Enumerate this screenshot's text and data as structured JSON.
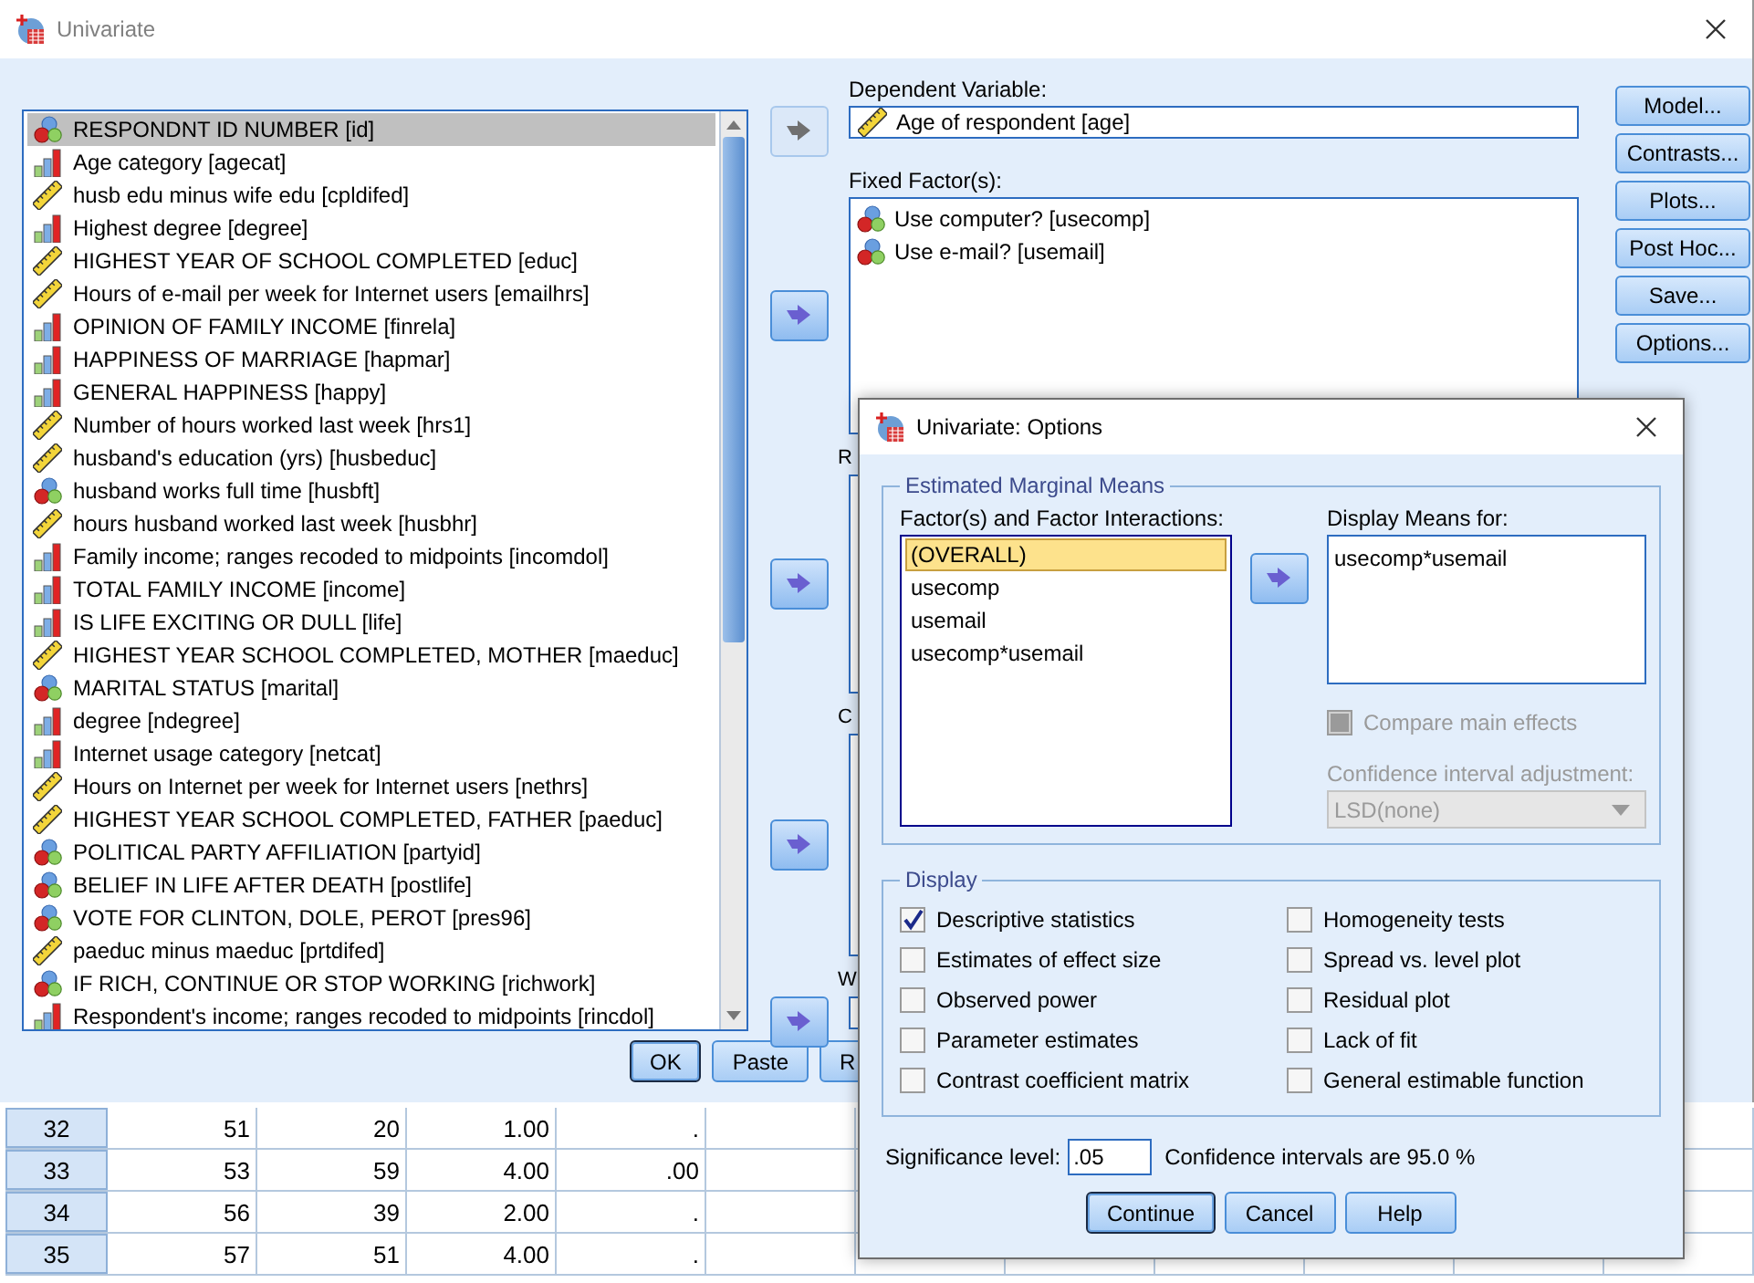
{
  "window": {
    "title": "Univariate"
  },
  "variables": [
    {
      "label": "RESPONDNT ID NUMBER [id]",
      "kind": "nominal",
      "selected": true
    },
    {
      "label": "Age category [agecat]",
      "kind": "ordinal",
      "selected": false
    },
    {
      "label": "husb edu minus wife edu [cpldifed]",
      "kind": "scale",
      "selected": false
    },
    {
      "label": "Highest degree [degree]",
      "kind": "ordinal",
      "selected": false
    },
    {
      "label": "HIGHEST YEAR OF SCHOOL COMPLETED [educ]",
      "kind": "scale",
      "selected": false
    },
    {
      "label": "Hours of e-mail per week for Internet users [emailhrs]",
      "kind": "scale",
      "selected": false
    },
    {
      "label": "OPINION OF FAMILY INCOME [finrela]",
      "kind": "ordinal",
      "selected": false
    },
    {
      "label": "HAPPINESS OF MARRIAGE [hapmar]",
      "kind": "ordinal",
      "selected": false
    },
    {
      "label": "GENERAL HAPPINESS [happy]",
      "kind": "ordinal",
      "selected": false
    },
    {
      "label": "Number of hours worked last week [hrs1]",
      "kind": "scale",
      "selected": false
    },
    {
      "label": "husband's education (yrs) [husbeduc]",
      "kind": "scale",
      "selected": false
    },
    {
      "label": "husband works full time [husbft]",
      "kind": "nominal",
      "selected": false
    },
    {
      "label": "hours husband worked last week [husbhr]",
      "kind": "scale",
      "selected": false
    },
    {
      "label": "Family income; ranges recoded to midpoints [incomdol]",
      "kind": "ordinal",
      "selected": false
    },
    {
      "label": "TOTAL FAMILY INCOME [income]",
      "kind": "ordinal",
      "selected": false
    },
    {
      "label": "IS LIFE EXCITING OR DULL [life]",
      "kind": "ordinal",
      "selected": false
    },
    {
      "label": "HIGHEST YEAR SCHOOL COMPLETED, MOTHER [maeduc]",
      "kind": "scale",
      "selected": false
    },
    {
      "label": "MARITAL STATUS [marital]",
      "kind": "nominal",
      "selected": false
    },
    {
      "label": "degree [ndegree]",
      "kind": "ordinal",
      "selected": false
    },
    {
      "label": "Internet usage category [netcat]",
      "kind": "ordinal",
      "selected": false
    },
    {
      "label": "Hours on Internet per week for Internet users [nethrs]",
      "kind": "scale",
      "selected": false
    },
    {
      "label": "HIGHEST YEAR SCHOOL COMPLETED, FATHER [paeduc]",
      "kind": "scale",
      "selected": false
    },
    {
      "label": "POLITICAL PARTY AFFILIATION [partyid]",
      "kind": "nominal",
      "selected": false
    },
    {
      "label": "BELIEF IN LIFE AFTER DEATH [postlife]",
      "kind": "nominal",
      "selected": false
    },
    {
      "label": "VOTE FOR CLINTON, DOLE, PEROT [pres96]",
      "kind": "nominal",
      "selected": false
    },
    {
      "label": "paeduc minus maeduc [prtdifed]",
      "kind": "scale",
      "selected": false
    },
    {
      "label": "IF RICH, CONTINUE OR STOP WORKING [richwork]",
      "kind": "nominal",
      "selected": false
    },
    {
      "label": "Respondent's income; ranges recoded to midpoints [rincdol]",
      "kind": "ordinal",
      "selected": false
    }
  ],
  "sections": [
    {
      "label": "Dependent Variable:",
      "kind": "field",
      "move_disabled": true,
      "items": [
        {
          "label": "Age of respondent [age]",
          "kind": "scale"
        }
      ]
    },
    {
      "label": "Fixed Factor(s):",
      "kind": "list",
      "move_disabled": false,
      "items": [
        {
          "label": "Use computer? [usecomp]",
          "kind": "nominal"
        },
        {
          "label": "Use e-mail? [usemail]",
          "kind": "nominal"
        }
      ]
    },
    {
      "label": "R",
      "kind": "list",
      "move_disabled": false
    },
    {
      "label": "C",
      "kind": "list",
      "move_disabled": false
    },
    {
      "label": "W",
      "kind": "field",
      "move_disabled": false
    }
  ],
  "side_buttons": [
    "Model...",
    "Contrasts...",
    "Plots...",
    "Post Hoc...",
    "Save...",
    "Options..."
  ],
  "bottom_buttons": [
    {
      "label": "OK",
      "default": true
    },
    {
      "label": "Paste",
      "default": false
    },
    {
      "label": "R",
      "default": false
    }
  ],
  "grid": {
    "rows": [
      {
        "header": "32",
        "cells": [
          "51",
          "20",
          "1.00",
          "."
        ]
      },
      {
        "header": "33",
        "cells": [
          "53",
          "59",
          "4.00",
          ".00"
        ]
      },
      {
        "header": "34",
        "cells": [
          "56",
          "39",
          "2.00",
          "."
        ]
      },
      {
        "header": "35",
        "cells": [
          "57",
          "51",
          "4.00",
          "."
        ]
      }
    ]
  },
  "options_dialog": {
    "title": "Univariate: Options",
    "marginal_means": {
      "title": "Estimated Marginal Means",
      "factors_label": "Factor(s) and Factor Interactions:",
      "factors": [
        {
          "label": "(OVERALL)",
          "selected": true
        },
        {
          "label": "usecomp",
          "selected": false
        },
        {
          "label": "usemail",
          "selected": false
        },
        {
          "label": "usecomp*usemail",
          "selected": false
        }
      ],
      "display_label": "Display Means for:",
      "display_items": [
        "usecomp*usemail"
      ],
      "compare": {
        "label": "Compare main effects",
        "checked": false,
        "disabled": true
      },
      "adjustment": {
        "label": "Confidence interval adjustment:",
        "value": "LSD(none)",
        "disabled": true
      }
    },
    "display": {
      "title": "Display",
      "left": [
        {
          "label": "Descriptive statistics",
          "checked": true
        },
        {
          "label": "Estimates of effect size",
          "checked": false
        },
        {
          "label": "Observed power",
          "checked": false
        },
        {
          "label": "Parameter estimates",
          "checked": false
        },
        {
          "label": "Contrast coefficient matrix",
          "checked": false
        }
      ],
      "right": [
        {
          "label": "Homogeneity tests",
          "checked": false
        },
        {
          "label": "Spread vs. level plot",
          "checked": false
        },
        {
          "label": "Residual plot",
          "checked": false
        },
        {
          "label": "Lack of fit",
          "checked": false
        },
        {
          "label": "General estimable function",
          "checked": false
        }
      ]
    },
    "significance": {
      "label": "Significance level:",
      "value": ".05",
      "note": "Confidence intervals are 95.0 %"
    },
    "buttons": [
      {
        "label": "Continue",
        "default": true
      },
      {
        "label": "Cancel",
        "default": false
      },
      {
        "label": "Help",
        "default": false
      }
    ]
  }
}
